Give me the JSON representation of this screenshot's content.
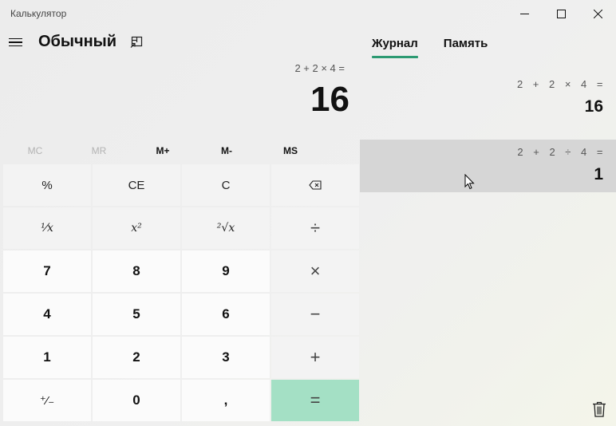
{
  "window": {
    "title": "Калькулятор",
    "controls": {
      "minimize": "─",
      "maximize": "☐",
      "close": "✕"
    }
  },
  "header": {
    "mode_title": "Обычный",
    "keep_on_top_icon": "keep-on-top-icon",
    "menu_icon": "hamburger-menu-icon"
  },
  "panel": {
    "tabs": [
      {
        "label": "Журнал",
        "active": true
      },
      {
        "label": "Память",
        "active": false
      }
    ]
  },
  "display": {
    "expression": "2 + 2 × 4 =",
    "result": "16"
  },
  "memory": [
    {
      "label": "MC",
      "enabled": false
    },
    {
      "label": "MR",
      "enabled": false
    },
    {
      "label": "M+",
      "enabled": true
    },
    {
      "label": "M-",
      "enabled": true
    },
    {
      "label": "MS",
      "enabled": true
    }
  ],
  "keypad": {
    "percent": "%",
    "ce": "CE",
    "c": "C",
    "backspace_icon": "backspace-icon",
    "reciprocal": "¹⁄x",
    "square": "x²",
    "sqrt": "²√x",
    "divide": "÷",
    "k7": "7",
    "k8": "8",
    "k9": "9",
    "multiply": "×",
    "k4": "4",
    "k5": "5",
    "k6": "6",
    "minus": "−",
    "k1": "1",
    "k2": "2",
    "k3": "3",
    "plus": "+",
    "negate": "⁺⁄₋",
    "k0": "0",
    "decimal": ",",
    "equals": "="
  },
  "history": [
    {
      "expression": "2 + 2 × 4 =",
      "result": "16"
    },
    {
      "expression": "2 + 2 ÷ 4 =",
      "result": "1"
    }
  ],
  "colors": {
    "accent": "#2c9a72",
    "equals_bg": "#a4e0c5",
    "selected_history_bg": "#d6d6d6"
  }
}
